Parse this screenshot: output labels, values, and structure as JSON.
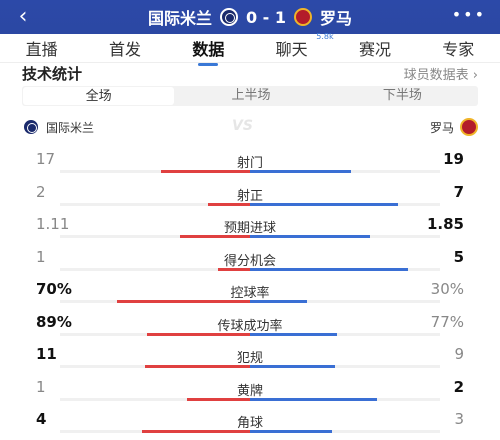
{
  "header": {
    "back_icon": "chevron-left-icon",
    "home_team": "国际米兰",
    "away_team": "罗马",
    "score": "0 - 1",
    "more_icon": "more-dots-icon",
    "colors": {
      "background": "#2b48a3",
      "text": "#ffffff"
    }
  },
  "tabs": [
    {
      "label": "直播"
    },
    {
      "label": "首发"
    },
    {
      "label": "数据",
      "active": true
    },
    {
      "label": "聊天",
      "badge": "5.8k"
    },
    {
      "label": "赛况"
    },
    {
      "label": "专家"
    }
  ],
  "section": {
    "title": "技术统计",
    "player_link": "球员数据表 ›"
  },
  "periods": [
    "全场",
    "上半场",
    "下半场"
  ],
  "active_period": "全场",
  "teams": {
    "home": "国际米兰",
    "away": "罗马",
    "vs": "VS"
  },
  "stats": [
    {
      "label": "射门",
      "home": "17",
      "away": "19",
      "home_share": 0.47,
      "leader": "away"
    },
    {
      "label": "射正",
      "home": "2",
      "away": "7",
      "home_share": 0.22,
      "leader": "away"
    },
    {
      "label": "预期进球",
      "home": "1.11",
      "away": "1.85",
      "home_share": 0.37,
      "leader": "away"
    },
    {
      "label": "得分机会",
      "home": "1",
      "away": "5",
      "home_share": 0.17,
      "leader": "away"
    },
    {
      "label": "控球率",
      "home": "70%",
      "away": "30%",
      "home_share": 0.7,
      "leader": "home"
    },
    {
      "label": "传球成功率",
      "home": "89%",
      "away": "77%",
      "home_share": 0.54,
      "leader": "home"
    },
    {
      "label": "犯规",
      "home": "11",
      "away": "9",
      "home_share": 0.55,
      "leader": "home"
    },
    {
      "label": "黄牌",
      "home": "1",
      "away": "2",
      "home_share": 0.33,
      "leader": "away"
    },
    {
      "label": "角球",
      "home": "4",
      "away": "3",
      "home_share": 0.57,
      "leader": "home"
    }
  ],
  "colors": {
    "home_bar": "#e04040",
    "away_bar": "#3a6fd4",
    "accent": "#3a78d6"
  }
}
